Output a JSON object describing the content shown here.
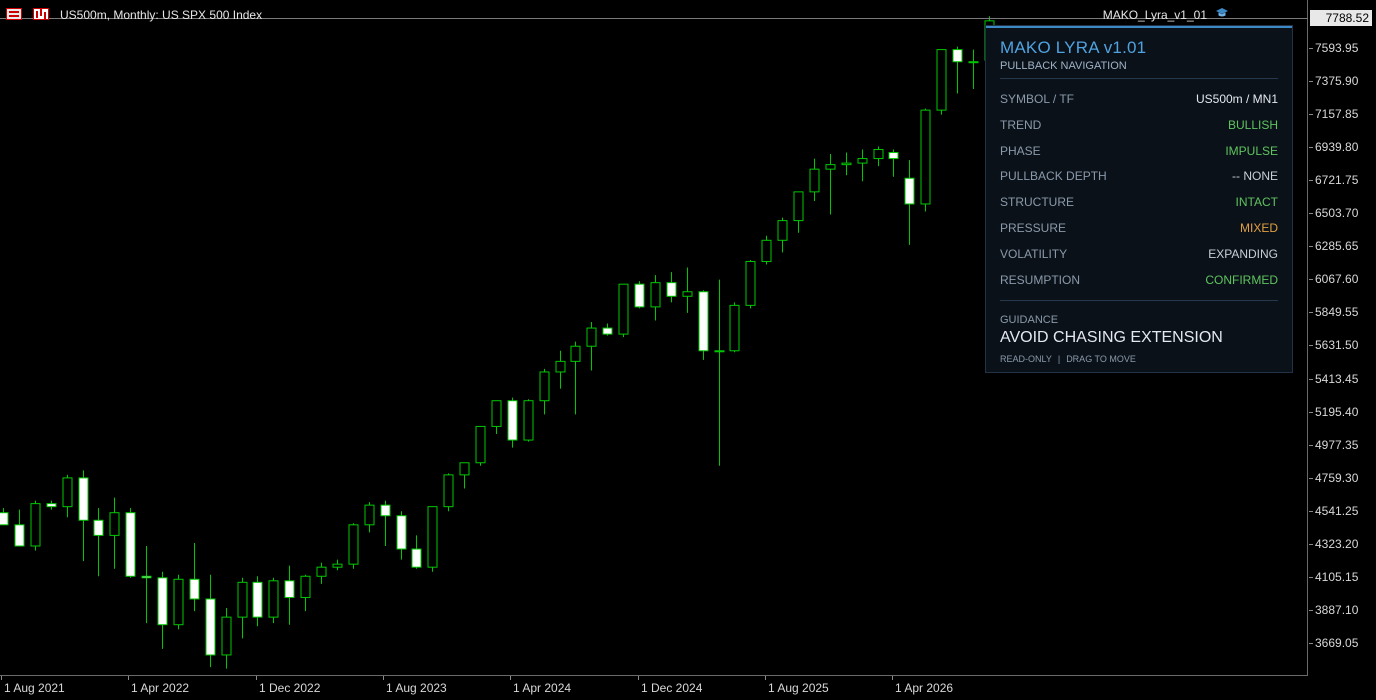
{
  "window": {
    "symbol_title": "US500m, Monthly:  US SPX 500 Index",
    "indicator_label": "MAKO_Lyra_v1_01",
    "toolbar_icons": [
      "table-icon",
      "bar-chart-icon"
    ],
    "indicator_icon": "graduation-cap-icon"
  },
  "price_axis": {
    "current_price": "7788.52",
    "labels": [
      "7593.95",
      "7375.90",
      "7157.85",
      "6939.80",
      "6721.75",
      "6503.70",
      "6285.65",
      "6067.60",
      "5849.55",
      "5631.50",
      "5413.45",
      "5195.40",
      "4977.35",
      "4759.30",
      "4541.25",
      "4323.20",
      "4105.15",
      "3887.10",
      "3669.05"
    ]
  },
  "time_axis": {
    "labels": [
      "1 Aug 2021",
      "1 Apr 2022",
      "1 Dec 2022",
      "1 Aug 2023",
      "1 Apr 2024",
      "1 Dec 2024",
      "1 Aug 2025",
      "1 Apr 2026"
    ]
  },
  "colors": {
    "background": "#000000",
    "bull_candle": "#00c800",
    "bear_candle": "#ffffff",
    "wick": "#00c800",
    "panel_title": "#4fa3e0",
    "value_green": "#5ec45e",
    "value_orange": "#e0a040",
    "value_white": "#e4e9ef"
  },
  "chart_data": {
    "type": "candlestick",
    "timeframe": "Monthly",
    "ylim": [
      3500,
      7800
    ],
    "candles": [
      [
        4530,
        4560,
        4450,
        4450
      ],
      [
        4450,
        4550,
        4320,
        4310
      ],
      [
        4310,
        4610,
        4280,
        4590
      ],
      [
        4590,
        4610,
        4550,
        4570
      ],
      [
        4570,
        4780,
        4500,
        4760
      ],
      [
        4760,
        4810,
        4210,
        4480
      ],
      [
        4480,
        4560,
        4110,
        4380
      ],
      [
        4380,
        4630,
        4160,
        4530
      ],
      [
        4530,
        4560,
        4100,
        4110
      ],
      [
        4110,
        4310,
        3800,
        4100
      ],
      [
        4100,
        4140,
        3630,
        3790
      ],
      [
        3790,
        4120,
        3760,
        4090
      ],
      [
        4090,
        4330,
        3880,
        3960
      ],
      [
        3960,
        4120,
        3510,
        3590
      ],
      [
        3590,
        3900,
        3500,
        3840
      ],
      [
        3840,
        4100,
        3700,
        4070
      ],
      [
        4070,
        4110,
        3780,
        3840
      ],
      [
        3840,
        4100,
        3800,
        4080
      ],
      [
        4080,
        4180,
        3790,
        3970
      ],
      [
        3970,
        4120,
        3880,
        4110
      ],
      [
        4110,
        4200,
        4060,
        4170
      ],
      [
        4170,
        4220,
        4150,
        4190
      ],
      [
        4190,
        4460,
        4160,
        4450
      ],
      [
        4450,
        4600,
        4400,
        4580
      ],
      [
        4580,
        4610,
        4310,
        4510
      ],
      [
        4510,
        4540,
        4220,
        4290
      ],
      [
        4290,
        4380,
        4160,
        4170
      ],
      [
        4170,
        4550,
        4140,
        4570
      ],
      [
        4570,
        4790,
        4540,
        4780
      ],
      [
        4780,
        4860,
        4690,
        4860
      ],
      [
        4860,
        5100,
        4840,
        5100
      ],
      [
        5100,
        5270,
        5050,
        5270
      ],
      [
        5270,
        5290,
        4960,
        5010
      ],
      [
        5010,
        5280,
        5000,
        5270
      ],
      [
        5270,
        5480,
        5180,
        5460
      ],
      [
        5460,
        5600,
        5350,
        5530
      ],
      [
        5530,
        5660,
        5180,
        5630
      ],
      [
        5630,
        5790,
        5470,
        5750
      ],
      [
        5750,
        5780,
        5700,
        5710
      ],
      [
        5710,
        6040,
        5690,
        6040
      ],
      [
        6040,
        6060,
        5880,
        5890
      ],
      [
        5890,
        6100,
        5800,
        6050
      ],
      [
        6050,
        6120,
        5920,
        5960
      ],
      [
        5960,
        6150,
        5850,
        5990
      ],
      [
        5990,
        6000,
        5540,
        5600
      ],
      [
        5600,
        6070,
        4840,
        5600
      ],
      [
        5600,
        5920,
        5590,
        5900
      ],
      [
        5900,
        6200,
        5880,
        6190
      ],
      [
        6190,
        6360,
        6170,
        6330
      ],
      [
        6330,
        6480,
        6250,
        6460
      ],
      [
        6460,
        6650,
        6380,
        6650
      ],
      [
        6650,
        6870,
        6590,
        6800
      ],
      [
        6800,
        6900,
        6500,
        6830
      ],
      [
        6830,
        6910,
        6760,
        6840
      ],
      [
        6840,
        6930,
        6720,
        6870
      ],
      [
        6870,
        6950,
        6820,
        6930
      ],
      [
        6910,
        6930,
        6750,
        6870
      ],
      [
        6740,
        6860,
        6300,
        6570
      ],
      [
        6570,
        7200,
        6520,
        7190
      ],
      [
        7190,
        7590,
        7160,
        7590
      ],
      [
        7590,
        7610,
        7300,
        7510
      ],
      [
        7510,
        7590,
        7330,
        7510
      ],
      [
        7520,
        7810,
        7500,
        7780
      ]
    ],
    "xlabel": "",
    "ylabel": ""
  },
  "panel": {
    "title": "MAKO LYRA v1.01",
    "subtitle": "PULLBACK NAVIGATION",
    "rows": [
      {
        "label": "SYMBOL / TF",
        "value": "US500m / MN1",
        "color": "#e4e9ef"
      },
      {
        "label": "TREND",
        "value": "BULLISH",
        "color": "#5ec45e"
      },
      {
        "label": "PHASE",
        "value": "IMPULSE",
        "color": "#5ec45e"
      },
      {
        "label": "PULLBACK DEPTH",
        "value": "--  NONE",
        "color": "#c8cfd6"
      },
      {
        "label": "STRUCTURE",
        "value": "INTACT",
        "color": "#5ec45e"
      },
      {
        "label": "PRESSURE",
        "value": "MIXED",
        "color": "#e0a040"
      },
      {
        "label": "VOLATILITY",
        "value": "EXPANDING",
        "color": "#c8cfd6"
      },
      {
        "label": "RESUMPTION",
        "value": "CONFIRMED",
        "color": "#5ec45e"
      }
    ],
    "guidance_label": "GUIDANCE",
    "guidance_text": "AVOID CHASING EXTENSION",
    "footer_readonly": "READ-ONLY",
    "footer_separator": "|",
    "footer_drag": "DRAG TO MOVE"
  }
}
